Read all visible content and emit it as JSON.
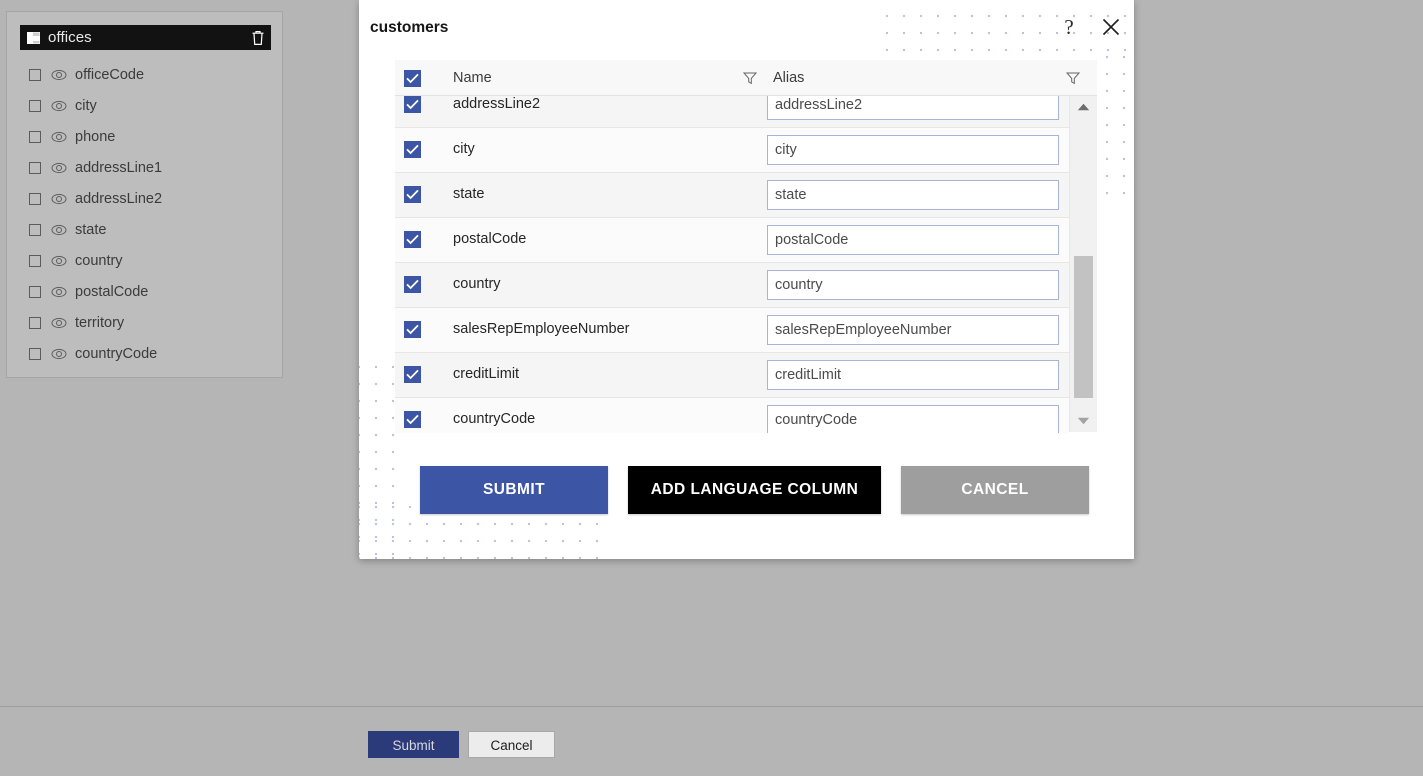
{
  "entity_panel": {
    "title": "offices",
    "table_icon": "table-icon",
    "delete_icon": "trash-icon",
    "fields": [
      {
        "label": "officeCode",
        "checked": false,
        "visibility_icon": "eye-icon"
      },
      {
        "label": "city",
        "checked": false,
        "visibility_icon": "eye-icon"
      },
      {
        "label": "phone",
        "checked": false,
        "visibility_icon": "eye-icon"
      },
      {
        "label": "addressLine1",
        "checked": false,
        "visibility_icon": "eye-icon"
      },
      {
        "label": "addressLine2",
        "checked": false,
        "visibility_icon": "eye-icon"
      },
      {
        "label": "state",
        "checked": false,
        "visibility_icon": "eye-icon"
      },
      {
        "label": "country",
        "checked": false,
        "visibility_icon": "eye-icon"
      },
      {
        "label": "postalCode",
        "checked": false,
        "visibility_icon": "eye-icon"
      },
      {
        "label": "territory",
        "checked": false,
        "visibility_icon": "eye-icon"
      },
      {
        "label": "countryCode",
        "checked": false,
        "visibility_icon": "eye-icon"
      }
    ]
  },
  "dialog": {
    "title": "customers",
    "help_icon": "question-mark-icon",
    "help_label": "?",
    "close_icon": "close-icon",
    "grid": {
      "select_all_checked": true,
      "columns": [
        {
          "label": "Name",
          "filter_icon": "filter-funnel-icon"
        },
        {
          "label": "Alias",
          "filter_icon": "filter-funnel-icon"
        }
      ],
      "rows": [
        {
          "checked": true,
          "name": "addressLine2",
          "alias": "addressLine2"
        },
        {
          "checked": true,
          "name": "city",
          "alias": "city"
        },
        {
          "checked": true,
          "name": "state",
          "alias": "state"
        },
        {
          "checked": true,
          "name": "postalCode",
          "alias": "postalCode"
        },
        {
          "checked": true,
          "name": "country",
          "alias": "country"
        },
        {
          "checked": true,
          "name": "salesRepEmployeeNumber",
          "alias": "salesRepEmployeeNumber"
        },
        {
          "checked": true,
          "name": "creditLimit",
          "alias": "creditLimit"
        },
        {
          "checked": true,
          "name": "countryCode",
          "alias": "countryCode"
        }
      ],
      "scrollbar": {
        "up_icon": "scroll-up-arrow-icon",
        "down_icon": "scroll-down-arrow-icon"
      }
    },
    "actions": {
      "submit": "SUBMIT",
      "add_language_column": "ADD LANGUAGE COLUMN",
      "cancel": "CANCEL"
    }
  },
  "bottom_bar": {
    "submit": "Submit",
    "cancel": "Cancel"
  },
  "colors": {
    "accent_blue": "#3d55a5",
    "page_submit_blue": "#2b3a78",
    "cancel_gray": "#9e9e9e",
    "black_button": "#000000",
    "page_background": "#b5b5b5",
    "panel_background": "#bdbdbd",
    "entity_header": "#121212",
    "dot_pattern": "#8f9cd6"
  }
}
